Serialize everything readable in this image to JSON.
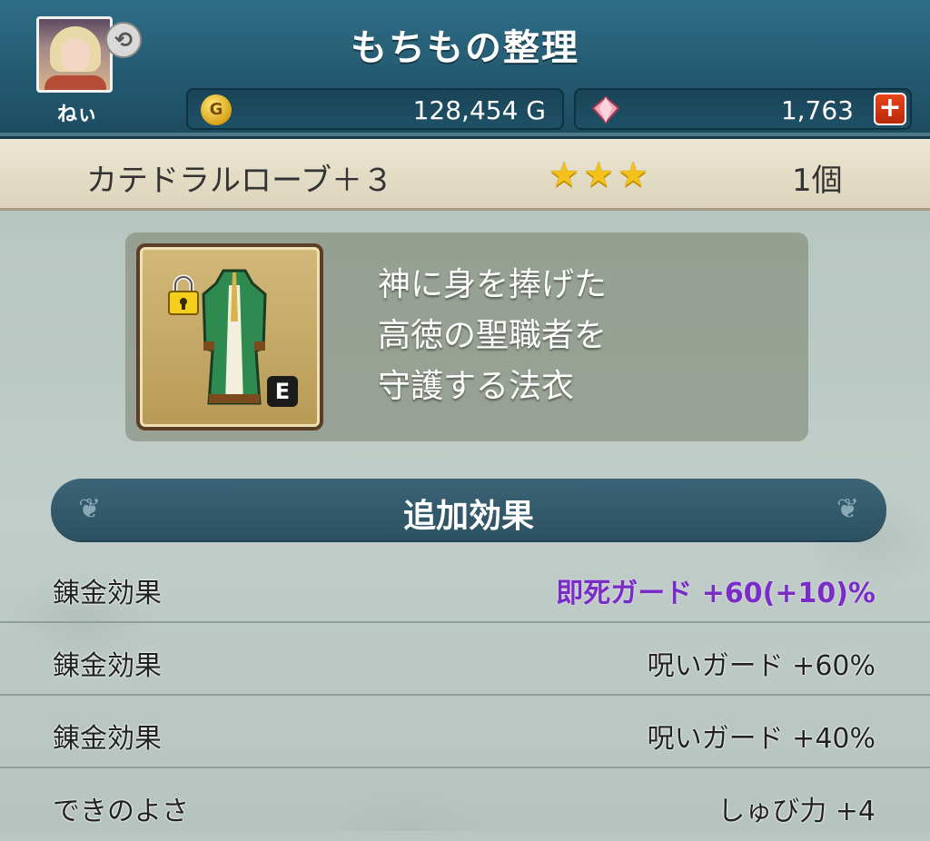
{
  "header": {
    "title": "もちもの整理",
    "player_name": "ねぃ",
    "gold_value": "128,454 G",
    "gem_value": "1,763",
    "plus_label": "+"
  },
  "icons": {
    "gold": "gold-coin-icon",
    "gem": "gem-icon",
    "swap": "swap-icon",
    "lock": "lock-icon",
    "star": "star-icon"
  },
  "item": {
    "name": "カテドラルローブ＋３",
    "stars": "★★★",
    "count": "1個",
    "equip_badge": "E",
    "description": [
      "神に身を捧げた",
      "高徳の聖職者を",
      "守護する法衣"
    ]
  },
  "section": {
    "title": "追加効果"
  },
  "effects": [
    {
      "label": "錬金効果",
      "value": "即死ガード +60(+10)%",
      "highlight": true
    },
    {
      "label": "錬金効果",
      "value": "呪いガード +60%",
      "highlight": false
    },
    {
      "label": "錬金効果",
      "value": "呪いガード +40%",
      "highlight": false
    },
    {
      "label": "できのよさ",
      "value": "しゅび力 +4",
      "highlight": false
    }
  ],
  "colors": {
    "header_bg": "#2f6d86",
    "highlight_effect": "#7a2cc6",
    "star": "#f2c21b",
    "plus_button": "#e9441d"
  }
}
